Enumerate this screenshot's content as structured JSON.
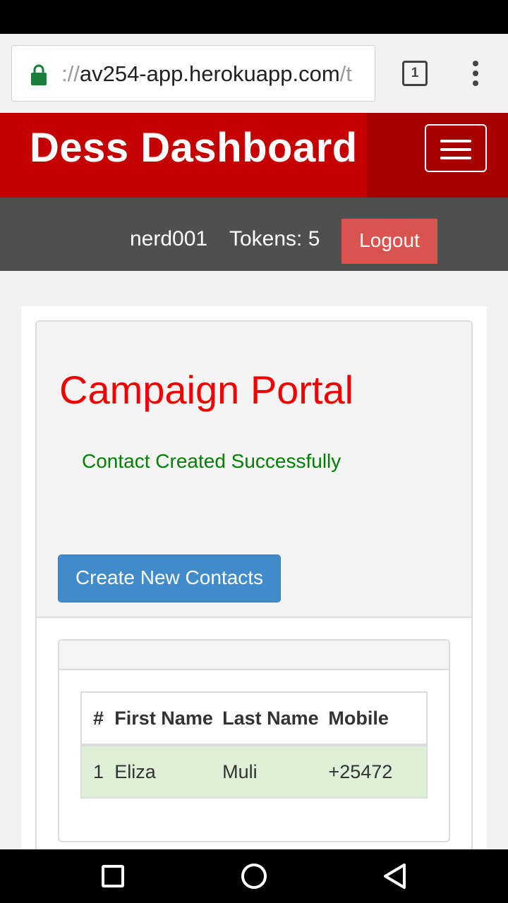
{
  "browser": {
    "url_scheme": "://",
    "url_host": "av254-app.herokuapp.com",
    "url_rest": "/t",
    "tab_count": "1"
  },
  "header": {
    "brand": "Dess Dashboard"
  },
  "user_bar": {
    "username": "nerd001",
    "tokens": "Tokens: 5",
    "logout_label": "Logout"
  },
  "page": {
    "title": "Campaign Portal",
    "success_message": "Contact Created Successfully",
    "create_button_label": "Create New Contacts"
  },
  "table": {
    "headers": [
      "#",
      "First Name",
      "Last Name",
      "Mobile"
    ],
    "rows": [
      [
        "1",
        "Eliza",
        "Muli",
        "+25472"
      ]
    ]
  },
  "colors": {
    "header_red": "#c40000",
    "title_red": "#f00000",
    "success_green": "#008000",
    "logout_bg": "#d9534f",
    "primary_button": "#428bca",
    "row_highlight": "#dff0d8"
  },
  "icons": {
    "lock": "lock-icon",
    "menu": "more-vert-icon",
    "hamburger": "hamburger-icon",
    "nav_back": "back-triangle-icon",
    "nav_home": "home-circle-icon",
    "nav_recents": "recents-square-icon"
  }
}
